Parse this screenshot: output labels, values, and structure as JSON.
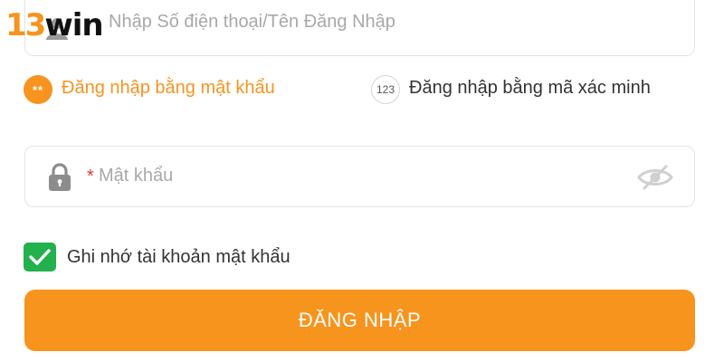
{
  "logo": {
    "number": "13",
    "word": "win"
  },
  "colors": {
    "accent": "#f7931e",
    "button": "#f7941d",
    "check": "#22b14c",
    "required": "#e53935"
  },
  "username": {
    "placeholder": "Nhập Số điện thoại/Tên Đăng Nhập",
    "icon": "user-icon"
  },
  "login_options": {
    "password": {
      "badge": "**",
      "label": "Đăng nhập bằng mật khẩu",
      "selected": true
    },
    "otp": {
      "badge": "123",
      "label": "Đăng nhập bằng mã xác minh",
      "selected": false
    }
  },
  "password": {
    "required_mark": "*",
    "placeholder": "Mật khẩu",
    "icon": "lock-icon",
    "toggle_icon": "eye-off-icon"
  },
  "remember": {
    "label": "Ghi nhớ tài khoản mật khẩu",
    "checked": true
  },
  "submit": {
    "label": "ĐĂNG NHẬP"
  }
}
